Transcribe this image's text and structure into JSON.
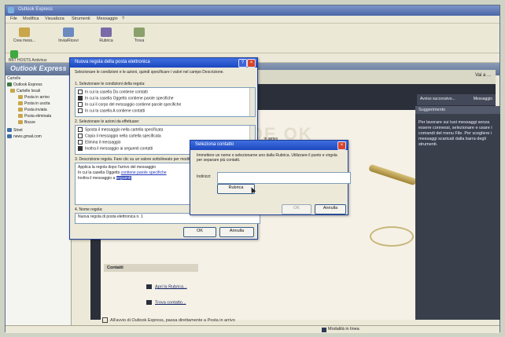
{
  "window": {
    "title": "Outlook Express"
  },
  "menu": [
    "File",
    "Modifica",
    "Visualizza",
    "Strumenti",
    "Messaggio",
    "?"
  ],
  "toolbar": [
    {
      "label": "Crea mess...",
      "icon": "new-mail-icon",
      "color": "#c9a64a"
    },
    {
      "label": "Invia/Ricevi",
      "icon": "send-receive-icon",
      "color": "#6c8ac0"
    },
    {
      "label": "Rubrica",
      "icon": "address-book-icon",
      "color": "#7a6aa8"
    },
    {
      "label": "Trova",
      "icon": "find-icon",
      "color": "#8aa06a"
    }
  ],
  "identity": {
    "label": "BBT HOSTS Antivirus"
  },
  "oe_bar": {
    "title": "Outlook Express",
    "right": "Vai a ..."
  },
  "folders": {
    "header": "Cartelle",
    "items": [
      {
        "label": "Outlook Express",
        "color": "#3f7a3f"
      },
      {
        "label": "Cartelle locali",
        "color": "#c9a64a"
      },
      {
        "label": "Posta in arrivo",
        "color": "#c9a64a"
      },
      {
        "label": "Posta in uscita",
        "color": "#c9a64a"
      },
      {
        "label": "Posta inviata",
        "color": "#c9a64a"
      },
      {
        "label": "Posta eliminata",
        "color": "#c9a64a"
      },
      {
        "label": "Bozze",
        "color": "#c9a64a"
      },
      {
        "label": "Stnet",
        "color": "#3f6fa8"
      },
      {
        "label": "news.gmail.com",
        "color": "#3f6fa8"
      }
    ]
  },
  "content": {
    "top_right": "Vai a ...",
    "watermark": "DE OK",
    "link_line": "... in arrivo",
    "contatti": "Contatti",
    "links": [
      "Apri la Rubrica...",
      "Trova contatto..."
    ],
    "footer_check": "All'avvio di Outlook Express, passa direttamente a Posta in arrivo"
  },
  "side_panel": {
    "header": "Suggerimento",
    "tab_left": "Avviso successivo...",
    "tab_right": "Messaggio",
    "text": "Per lavorare sui tuoi messaggi senza essere connessi, selezionare e usare i comandi del menu File. Per scegliere i messaggi scaricati dalla barra degli strumenti."
  },
  "status": {
    "text": "Modalità in linea"
  },
  "dialog_rule": {
    "title": "Nuova regola della posta elettronica",
    "intro": "Selezionare le condizioni e le azioni, quindi specificare i valori nel campo Descrizione.",
    "section1": "1. Selezionare le condizioni della regola:",
    "conditions": [
      {
        "label": "In cui la casella Da contiene contatti",
        "checked": false
      },
      {
        "label": "In cui la casella Oggetto contiene parole specifiche",
        "checked": true
      },
      {
        "label": "In cui il corpo del messaggio contiene parole specifiche",
        "checked": false
      },
      {
        "label": "In cui la casella A contiene contatti",
        "checked": false
      }
    ],
    "section2": "2. Selezionare le azioni da effettuare:",
    "actions": [
      {
        "label": "Sposta il messaggio nella cartella specificata",
        "checked": false
      },
      {
        "label": "Copia il messaggio nella cartella specificata",
        "checked": false
      },
      {
        "label": "Elimina il messaggio",
        "checked": false
      },
      {
        "label": "Inoltra il messaggio ai seguenti contatti",
        "checked": true
      }
    ],
    "section3": "3. Descrizione regola. Fare clic su un valore sottolineato per modificarlo:",
    "desc_line1": "Applica la regola dopo l'arrivo del messaggio",
    "desc_line2_prefix": "In cui la casella Oggetto ",
    "desc_line2_link": "contiene parole specifiche",
    "desc_line3_prefix": "Inoltra il messaggio a ",
    "desc_line3_link": "seguenti",
    "section4": "4. Nome regola:",
    "rule_name": "Nuova regola di posta elettronica n. 1",
    "ok": "OK",
    "cancel": "Annulla"
  },
  "dialog_contact": {
    "title": "Seleziona contatto",
    "intro": "Immettere un nome o selezionarne uno dalla Rubrica. Utilizzare il punto e virgola per separare più contatti.",
    "field_label": "Indirizzi:",
    "field_value": "",
    "rubrica": "Rubrica",
    "ok": "OK",
    "cancel": "Annulla"
  }
}
